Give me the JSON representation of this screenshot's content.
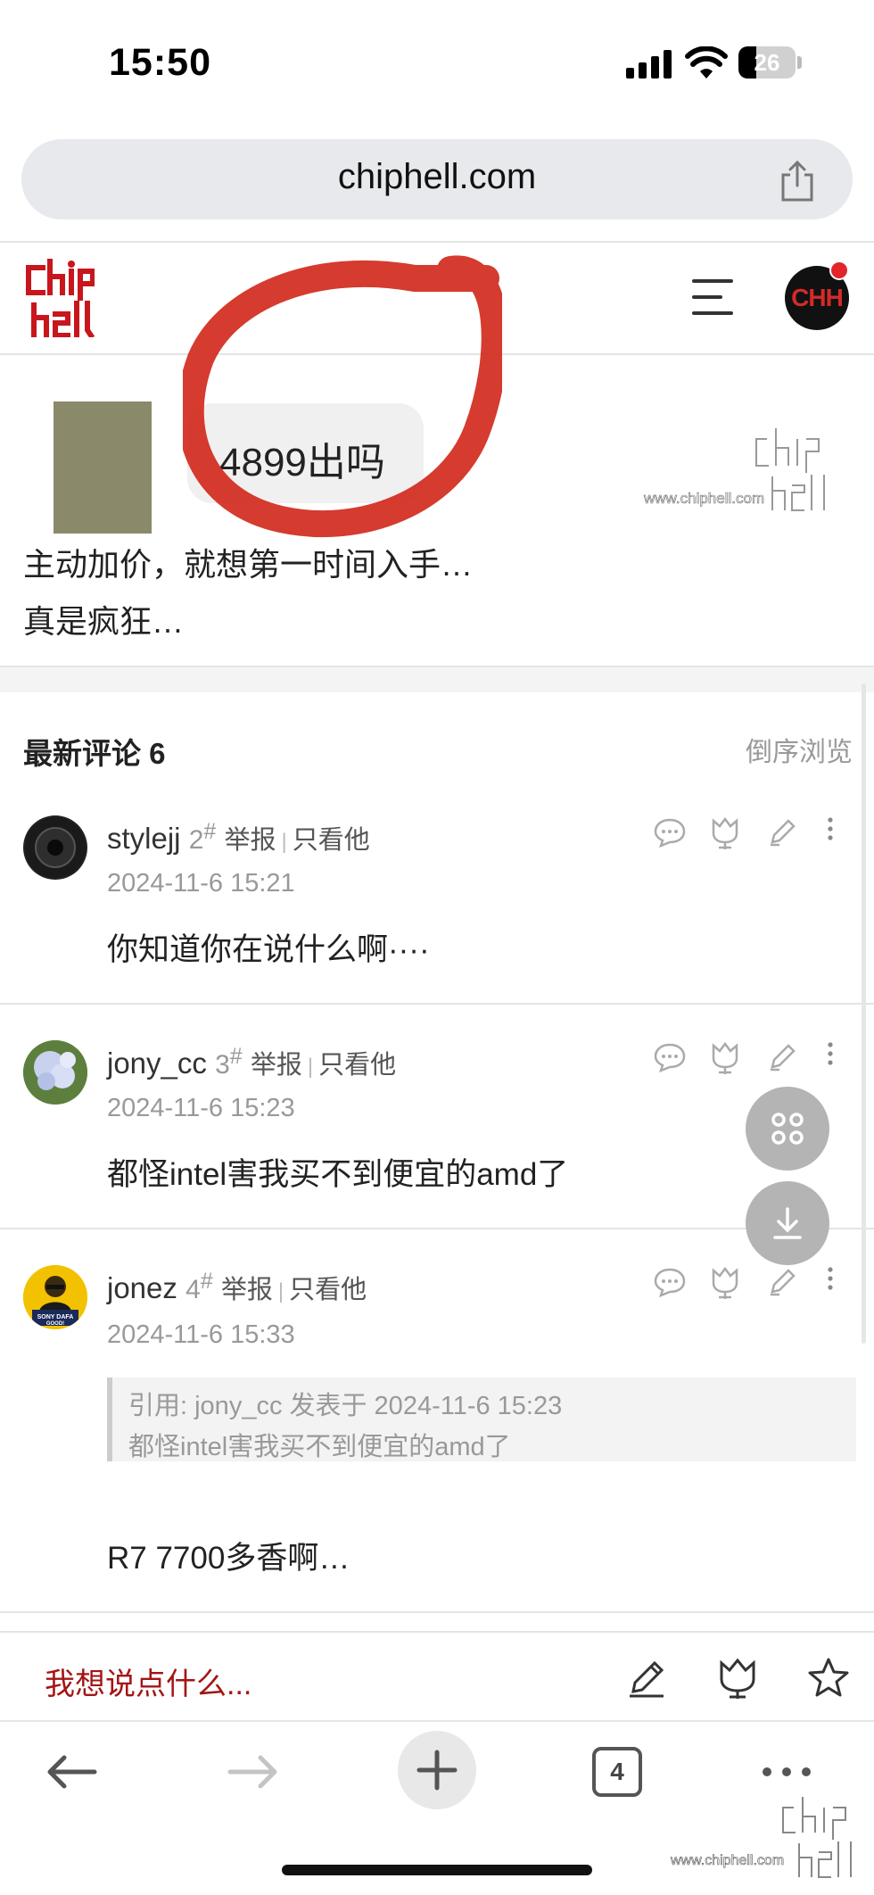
{
  "status_bar": {
    "time": "15:50",
    "battery": "26"
  },
  "browser": {
    "url": "chiphell.com",
    "tab_count": "4"
  },
  "site": {
    "avatar_text": "CHH"
  },
  "post": {
    "image_bubble_text": "4899出吗",
    "watermark_text": "www.chiphell.com",
    "lines": [
      "主动加价，就想第一时间入手…",
      "真是疯狂…"
    ]
  },
  "comments": {
    "title": "最新评论 6",
    "sort_label": "倒序浏览",
    "report_label": "举报",
    "only_him_label": "只看他",
    "items": [
      {
        "user": "stylejj",
        "floor": "2",
        "date": "2024-11-6 15:21",
        "body": "你知道你在说什么啊····"
      },
      {
        "user": "jony_cc",
        "floor": "3",
        "date": "2024-11-6 15:23",
        "body": "都怪intel害我买不到便宜的amd了"
      },
      {
        "user": "jonez",
        "floor": "4",
        "date": "2024-11-6 15:33",
        "quote_header": "引用: jony_cc 发表于 2024-11-6 15:23",
        "quote_body": "都怪intel害我买不到便宜的amd了",
        "body": "R7 7700多香啊…",
        "avatar_text": "SONY DAFA GOOD!"
      }
    ]
  },
  "reply_bar": {
    "placeholder": "我想说点什么..."
  },
  "icons": [
    "share-icon",
    "menu-icon",
    "comment-icon",
    "flower-icon",
    "edit-icon",
    "more-icon",
    "apps-icon",
    "download-icon",
    "pencil-icon",
    "star-icon",
    "back-icon",
    "forward-icon",
    "new-tab-icon",
    "tabs-icon"
  ],
  "colors": {
    "brand_red": "#c8161d",
    "reply_red": "#a31515"
  }
}
